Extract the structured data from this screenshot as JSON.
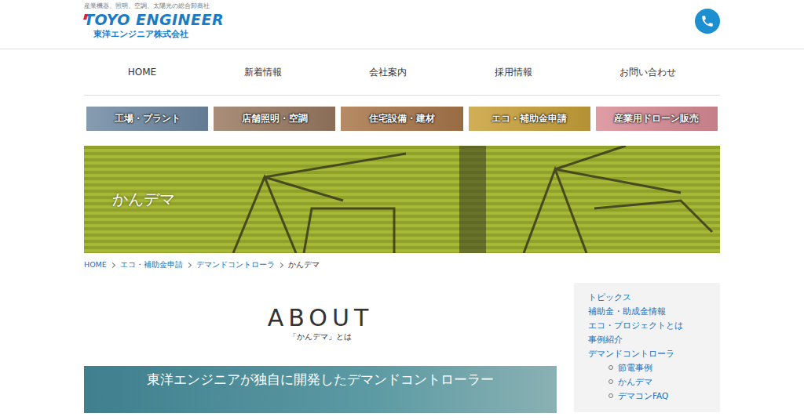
{
  "header": {
    "tagline": "産業機器、照明、空調、太陽光の総合卸商社",
    "logo": "TOYO ENGINEER",
    "company": "東洋エンジニア株式会社"
  },
  "nav": [
    "HOME",
    "新着情報",
    "会社案内",
    "採用情報",
    "お問い合わせ"
  ],
  "categories": [
    {
      "label": "工場・プラント",
      "color": "#6f8aa3"
    },
    {
      "label": "店舗照明・空調",
      "color": "#9a7a62"
    },
    {
      "label": "住宅設備・建材",
      "color": "#a9774a"
    },
    {
      "label": "エコ・補助金申請",
      "color": "#c9a13a"
    },
    {
      "label": "産業用ドローン販売",
      "color": "#d98c96"
    }
  ],
  "hero": {
    "title": "かんデマ"
  },
  "breadcrumb": [
    {
      "label": "HOME",
      "link": true
    },
    {
      "label": "エコ・補助金申請",
      "link": true
    },
    {
      "label": "デマンドコントローラ",
      "link": true
    },
    {
      "label": "かんデマ",
      "link": false
    }
  ],
  "about": {
    "heading": "ABOUT",
    "subtitle": "「かんデマ」とは",
    "banner": "東洋エンジニアが独自に開発したデマンドコントローラー"
  },
  "sidebar": [
    {
      "label": "トピックス",
      "kind": "main"
    },
    {
      "label": "補助金・助成金情報",
      "kind": "main"
    },
    {
      "label": "エコ・プロジェクトとは",
      "kind": "main"
    },
    {
      "label": "事例紹介",
      "kind": "main"
    },
    {
      "label": "デマンドコントローラ",
      "kind": "main"
    },
    {
      "label": "節電事例",
      "kind": "sub"
    },
    {
      "label": "かんデマ",
      "kind": "sub"
    },
    {
      "label": "デマコンFAQ",
      "kind": "sub"
    }
  ]
}
